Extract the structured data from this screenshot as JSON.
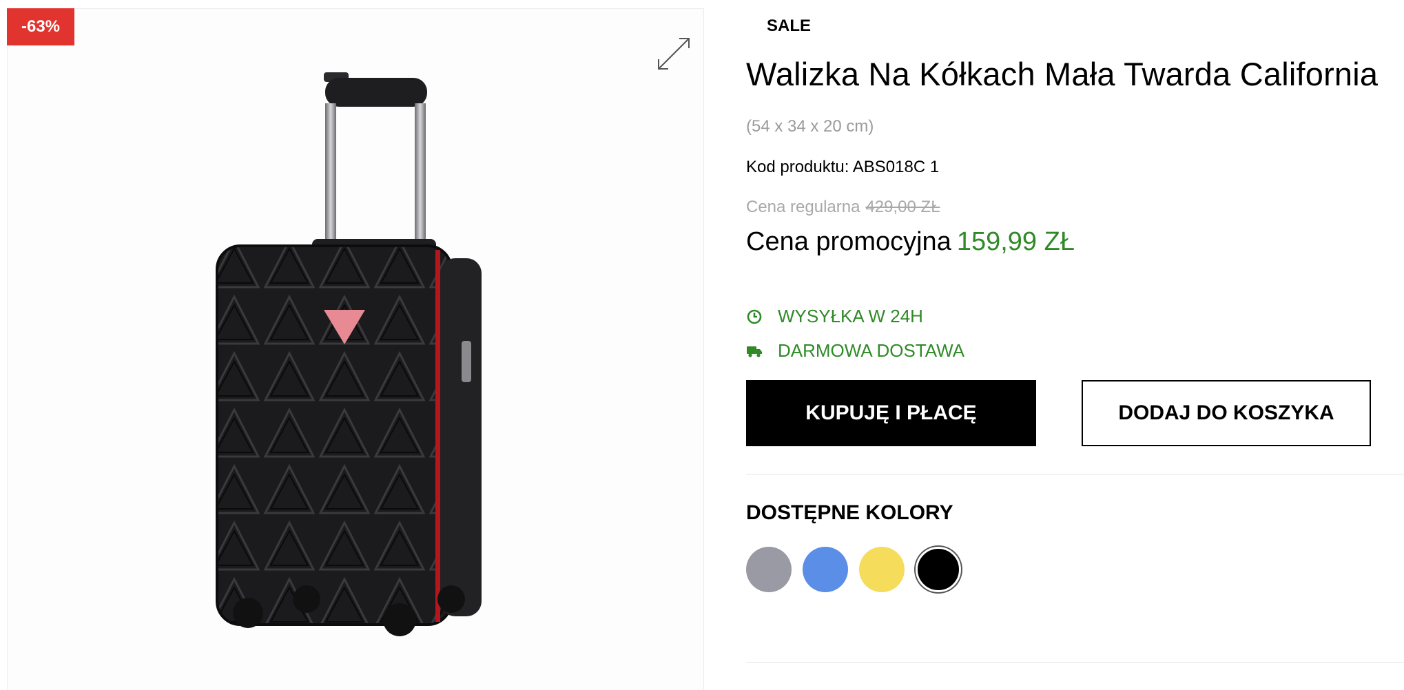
{
  "badge": {
    "discount": "-63%"
  },
  "gallery": {
    "image_alt": "Black hard-shell cabin suitcase with telescopic handle"
  },
  "product": {
    "category": "SALE",
    "title": "Walizka Na Kółkach Mała Twarda California",
    "dimensions": "(54 x 34 x 20 cm)",
    "code": "Kod produktu: ABS018C 1",
    "regular_label": "Cena regularna",
    "regular_price": "429,00 ZŁ",
    "promo_label": "Cena promocyjna",
    "promo_price": "159,99 ZŁ"
  },
  "features": [
    {
      "label": "WYSYŁKA W 24H",
      "icon": "clock-icon"
    },
    {
      "label": "DARMOWA DOSTAWA",
      "icon": "truck-icon"
    }
  ],
  "actions": {
    "buy_label": "KUPUJĘ I PŁACĘ",
    "cart_label": "DODAJ DO KOSZYKA"
  },
  "colors": {
    "title": "DOSTĘPNE KOLORY",
    "options": [
      {
        "name": "grey",
        "hex": "#9a9aa5",
        "selected": false
      },
      {
        "name": "blue",
        "hex": "#5b8ee6",
        "selected": false
      },
      {
        "name": "yellow",
        "hex": "#f5dc5a",
        "selected": false
      },
      {
        "name": "black",
        "hex": "#000000",
        "selected": true
      }
    ]
  },
  "theme": {
    "accent_green": "#2f8a27",
    "badge_red": "#e2342f"
  }
}
